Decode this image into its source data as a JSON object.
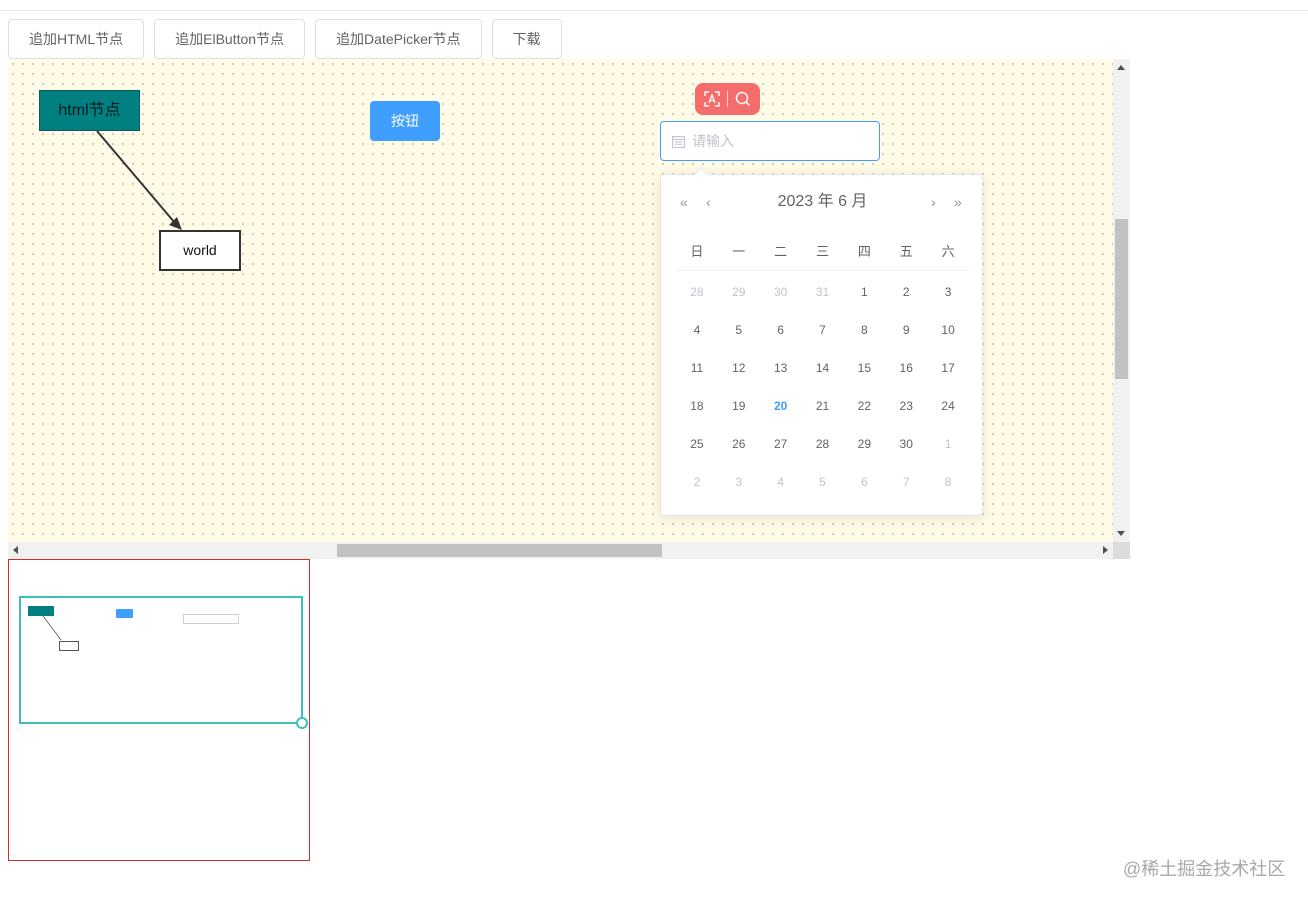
{
  "toolbar": {
    "buttons": [
      {
        "label": "追加HTML节点"
      },
      {
        "label": "追加ElButton节点"
      },
      {
        "label": "追加DatePicker节点"
      },
      {
        "label": "下载"
      }
    ]
  },
  "canvas": {
    "html_node": {
      "label": "html节点"
    },
    "world_node": {
      "label": "world"
    },
    "el_button": {
      "label": "按钮"
    },
    "floating_toolbar": {
      "icons": [
        "text-recognition-icon",
        "search-icon"
      ]
    },
    "date_input": {
      "placeholder": "请输入",
      "icon": "calendar-icon"
    }
  },
  "date_picker": {
    "nav": {
      "prev_year": "«",
      "prev_month": "‹",
      "next_month": "›",
      "next_year": "»"
    },
    "title": "2023 年  6 月",
    "weekdays": [
      "日",
      "一",
      "二",
      "三",
      "四",
      "五",
      "六"
    ],
    "days": [
      [
        "28",
        "29",
        "30",
        "31",
        "1",
        "2",
        "3"
      ],
      [
        "4",
        "5",
        "6",
        "7",
        "8",
        "9",
        "10"
      ],
      [
        "11",
        "12",
        "13",
        "14",
        "15",
        "16",
        "17"
      ],
      [
        "18",
        "19",
        "20",
        "21",
        "22",
        "23",
        "24"
      ],
      [
        "25",
        "26",
        "27",
        "28",
        "29",
        "30",
        "1"
      ],
      [
        "2",
        "3",
        "4",
        "5",
        "6",
        "7",
        "8"
      ]
    ],
    "today": "20",
    "colors": {
      "accent": "#409eff",
      "muted": "#c0c4cc"
    }
  },
  "watermark": "@稀土掘金技术社区",
  "colors": {
    "html_node_bg": "#008080",
    "button_primary": "#409eff",
    "floating_toolbar": "#f56c6c",
    "minimap_border": "#d42a2a",
    "minimap_viewport": "#3cc0b8",
    "canvas_bg": "#fffbe6"
  }
}
